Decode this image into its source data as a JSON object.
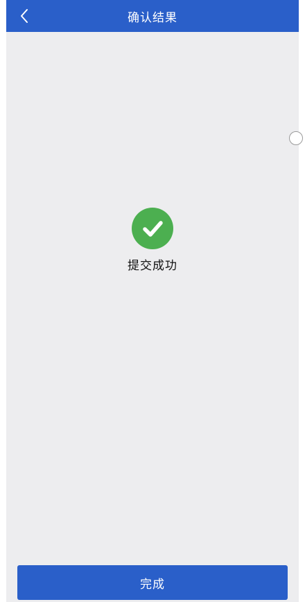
{
  "header": {
    "title": "确认结果",
    "back_icon": "chevron-left-icon"
  },
  "result": {
    "icon": "check-circle-icon",
    "status": "提交成功",
    "accent_color": "#4caf50"
  },
  "footer": {
    "done_label": "完成"
  },
  "theme": {
    "primary": "#2a5fc9",
    "background": "#ededef"
  }
}
